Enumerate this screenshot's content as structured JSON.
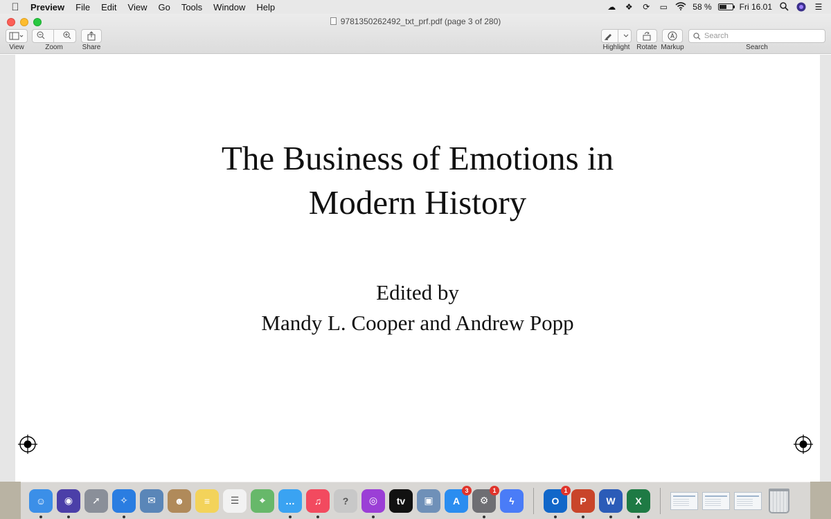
{
  "menubar": {
    "app_name": "Preview",
    "items": [
      "File",
      "Edit",
      "View",
      "Go",
      "Tools",
      "Window",
      "Help"
    ],
    "battery_percent": "58 %",
    "battery_level": 0.58,
    "clock": "Fri 16.01"
  },
  "window": {
    "title": "9781350262492_txt_prf.pdf (page 3 of 280)",
    "toolbar": {
      "view_label": "View",
      "zoom_label": "Zoom",
      "share_label": "Share",
      "highlight_label": "Highlight",
      "rotate_label": "Rotate",
      "markup_label": "Markup",
      "search_label": "Search",
      "search_placeholder": "Search"
    }
  },
  "document": {
    "title_line1": "The Business of Emotions in",
    "title_line2": "Modern History",
    "edited_by": "Edited by",
    "editors": "Mandy L. Cooper and Andrew Popp"
  },
  "dock": {
    "apps": [
      {
        "name": "finder",
        "color": "#3b8fe8",
        "glyph": "☺",
        "badge": ""
      },
      {
        "name": "siri",
        "color": "#4b3fa8",
        "glyph": "◉",
        "badge": ""
      },
      {
        "name": "launchpad",
        "color": "#8a8f99",
        "glyph": "➚",
        "badge": ""
      },
      {
        "name": "safari",
        "color": "#2a7de1",
        "glyph": "✧",
        "badge": ""
      },
      {
        "name": "mail",
        "color": "#5a86b8",
        "glyph": "✉",
        "badge": ""
      },
      {
        "name": "contacts",
        "color": "#b08a5a",
        "glyph": "☻",
        "badge": ""
      },
      {
        "name": "notes",
        "color": "#f3d35a",
        "glyph": "≡",
        "badge": ""
      },
      {
        "name": "reminders",
        "color": "#f2f2f2",
        "glyph": "☰",
        "badge": ""
      },
      {
        "name": "maps",
        "color": "#67b86a",
        "glyph": "⌖",
        "badge": ""
      },
      {
        "name": "messages",
        "color": "#3aa3f2",
        "glyph": "…",
        "badge": ""
      },
      {
        "name": "music",
        "color": "#f24a5f",
        "glyph": "♫",
        "badge": ""
      },
      {
        "name": "help",
        "color": "#c8c8c8",
        "glyph": "?",
        "badge": ""
      },
      {
        "name": "podcasts",
        "color": "#9b3fd6",
        "glyph": "◎",
        "badge": ""
      },
      {
        "name": "apple-tv",
        "color": "#111111",
        "glyph": "tv",
        "badge": ""
      },
      {
        "name": "preview",
        "color": "#6f90b8",
        "glyph": "▣",
        "badge": ""
      },
      {
        "name": "app-store",
        "color": "#2a8df0",
        "glyph": "A",
        "badge": "3"
      },
      {
        "name": "system-preferences",
        "color": "#6e6e73",
        "glyph": "⚙",
        "badge": "1"
      },
      {
        "name": "messenger",
        "color": "#4a7cf7",
        "glyph": "ϟ",
        "badge": ""
      },
      {
        "name": "outlook",
        "color": "#1167c9",
        "glyph": "O",
        "badge": "1"
      },
      {
        "name": "powerpoint",
        "color": "#c9452a",
        "glyph": "P",
        "badge": ""
      },
      {
        "name": "word",
        "color": "#2b5cb8",
        "glyph": "W",
        "badge": ""
      },
      {
        "name": "excel",
        "color": "#1e7a44",
        "glyph": "X",
        "badge": ""
      }
    ]
  }
}
